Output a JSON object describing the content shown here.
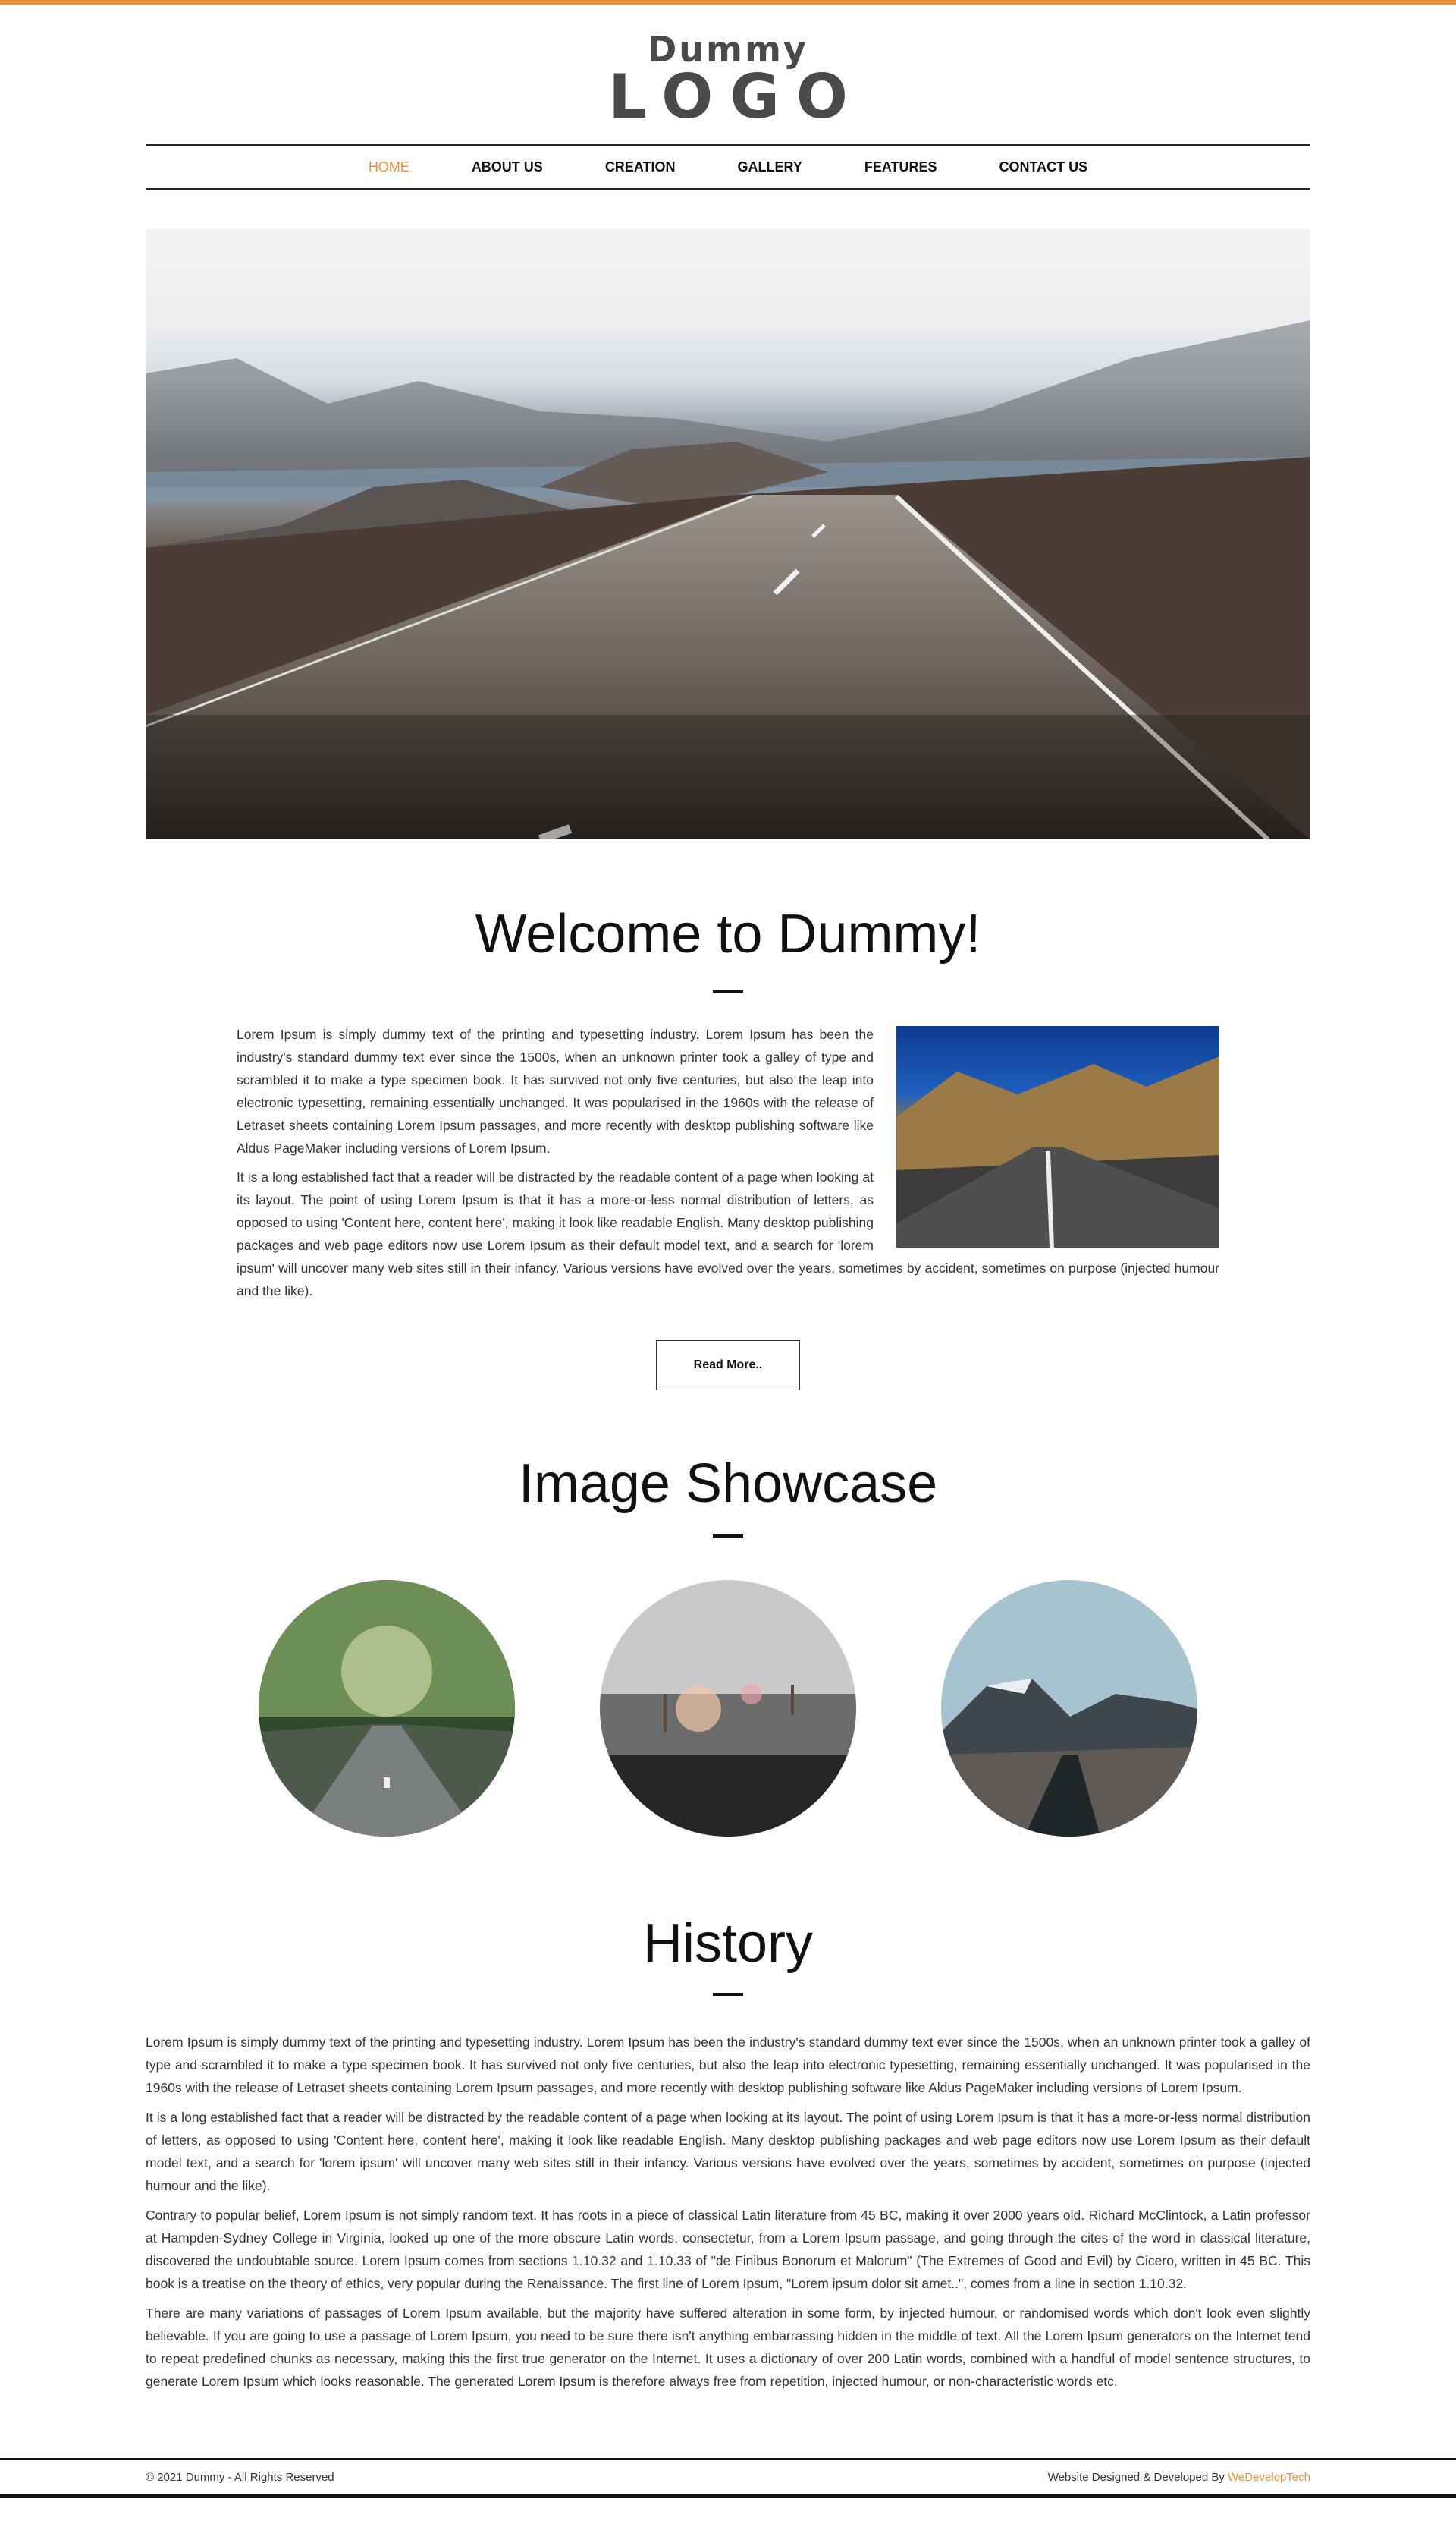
{
  "logo": {
    "line1": "Dummy",
    "line2": "LOGO"
  },
  "nav": [
    "HOME",
    "ABOUT US",
    "CREATION",
    "GALLERY",
    "FEATURES",
    "CONTACT US"
  ],
  "welcome": {
    "title": "Welcome to Dummy!",
    "p1": "Lorem Ipsum is simply dummy text of the printing and typesetting industry. Lorem Ipsum has been the industry's standard dummy text ever since the 1500s, when an unknown printer took a galley of type and scrambled it to make a type specimen book. It has survived not only five centuries, but also the leap into electronic typesetting, remaining essentially unchanged. It was popularised in the 1960s with the release of Letraset sheets containing Lorem Ipsum passages, and more recently with desktop publishing software like Aldus PageMaker including versions of Lorem Ipsum.",
    "p2": "It is a long established fact that a reader will be distracted by the readable content of a page when looking at its layout. The point of using Lorem Ipsum is that it has a more-or-less normal distribution of letters, as opposed to using 'Content here, content here', making it look like readable English. Many desktop publishing packages and web page editors now use Lorem Ipsum as their default model text, and a search for 'lorem ipsum' will uncover many web sites still in their infancy. Various versions have evolved over the years, sometimes by accident, sometimes on purpose (injected humour and the like).",
    "button": "Read More.."
  },
  "showcase": {
    "title": "Image Showcase"
  },
  "history": {
    "title": "History",
    "p1": "Lorem Ipsum is simply dummy text of the printing and typesetting industry. Lorem Ipsum has been the industry's standard dummy text ever since the 1500s, when an unknown printer took a galley of type and scrambled it to make a type specimen book. It has survived not only five centuries, but also the leap into electronic typesetting, remaining essentially unchanged. It was popularised in the 1960s with the release of Letraset sheets containing Lorem Ipsum passages, and more recently with desktop publishing software like Aldus PageMaker including versions of Lorem Ipsum.",
    "p2": "It is a long established fact that a reader will be distracted by the readable content of a page when looking at its layout. The point of using Lorem Ipsum is that it has a more-or-less normal distribution of letters, as opposed to using 'Content here, content here', making it look like readable English. Many desktop publishing packages and web page editors now use Lorem Ipsum as their default model text, and a search for 'lorem ipsum' will uncover many web sites still in their infancy. Various versions have evolved over the years, sometimes by accident, sometimes on purpose (injected humour and the like).",
    "p3": "Contrary to popular belief, Lorem Ipsum is not simply random text. It has roots in a piece of classical Latin literature from 45 BC, making it over 2000 years old. Richard McClintock, a Latin professor at Hampden-Sydney College in Virginia, looked up one of the more obscure Latin words, consectetur, from a Lorem Ipsum passage, and going through the cites of the word in classical literature, discovered the undoubtable source. Lorem Ipsum comes from sections 1.10.32 and 1.10.33 of \"de Finibus Bonorum et Malorum\" (The Extremes of Good and Evil) by Cicero, written in 45 BC. This book is a treatise on the theory of ethics, very popular during the Renaissance. The first line of Lorem Ipsum, \"Lorem ipsum dolor sit amet..\", comes from a line in section 1.10.32.",
    "p4": "There are many variations of passages of Lorem Ipsum available, but the majority have suffered alteration in some form, by injected humour, or randomised words which don't look even slightly believable. If you are going to use a passage of Lorem Ipsum, you need to be sure there isn't anything embarrassing hidden in the middle of text. All the Lorem Ipsum generators on the Internet tend to repeat predefined chunks as necessary, making this the first true generator on the Internet. It uses a dictionary of over 200 Latin words, combined with a handful of model sentence structures, to generate Lorem Ipsum which looks reasonable. The generated Lorem Ipsum is therefore always free from repetition, injected humour, or non-characteristic words etc."
  },
  "footer": {
    "copyright": "© 2021 Dummy - All Rights Reserved",
    "credit_prefix": "Website Designed & Developed By ",
    "credit_brand": "WeDevelopTech"
  },
  "colors": {
    "accent": "#e8903e",
    "text": "#333333",
    "heading": "#111111"
  }
}
